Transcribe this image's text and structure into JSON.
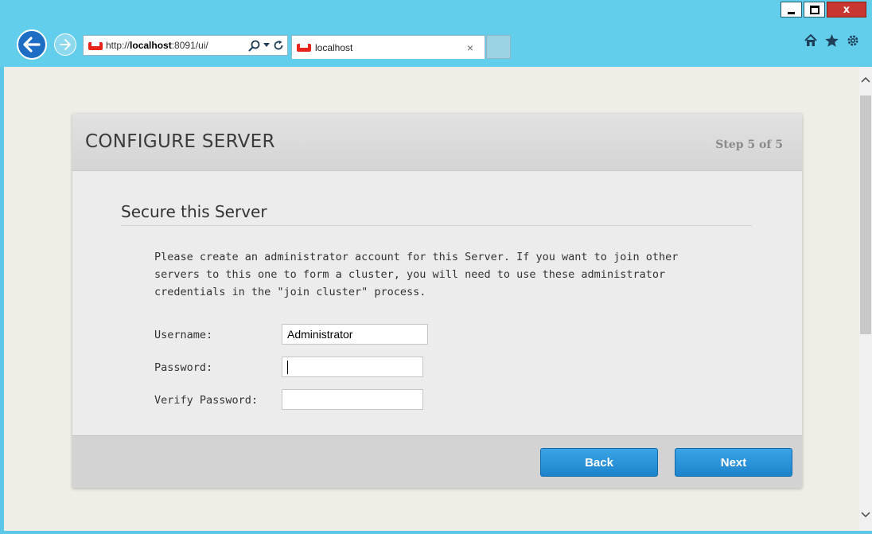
{
  "browser": {
    "url_prefix": "http://",
    "url_host": "localhost",
    "url_suffix": ":8091/ui/",
    "tab_title": "localhost",
    "tab_close": "×",
    "window_close": "x",
    "accent_color": "#63cdec"
  },
  "wizard": {
    "title": "CONFIGURE SERVER",
    "step": "Step 5 of 5",
    "section_title": "Secure this Server",
    "intro": "Please create an administrator account for this Server. If you want to join other servers to this one to form a cluster, you will need to use these administrator credentials in the \"join cluster\" process.",
    "fields": {
      "username_label": "Username:",
      "username_value": "Administrator",
      "password_label": "Password:",
      "password_value": "",
      "verify_label": "Verify Password:",
      "verify_value": ""
    },
    "buttons": {
      "back": "Back",
      "next": "Next"
    },
    "button_color": "#1d84cc"
  }
}
